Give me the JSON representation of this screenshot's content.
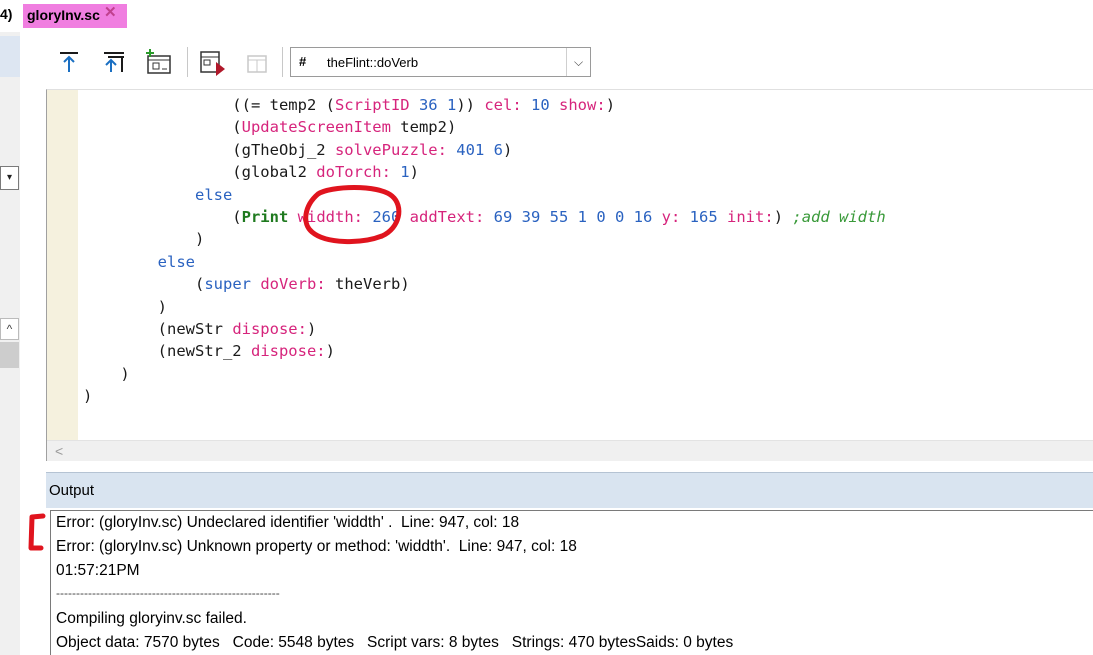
{
  "tabs": {
    "prev_label": "4)",
    "active_label": "gloryInv.sc",
    "close_symbol": "✕"
  },
  "toolbar": {
    "method_hash": "#",
    "method_value": "theFlint::doVerb",
    "dropdown_arrow": "⌵"
  },
  "left_strip": {
    "dropdown_arrow": "▾",
    "scroll_up": "^"
  },
  "editor": {
    "scroll_left": "<",
    "lines": [
      [
        {
          "t": "                ((= temp2 (",
          "c": "t-black"
        },
        {
          "t": "ScriptID",
          "c": "t-magenta"
        },
        {
          "t": " ",
          "c": "t-black"
        },
        {
          "t": "36",
          "c": "t-num"
        },
        {
          "t": " ",
          "c": "t-black"
        },
        {
          "t": "1",
          "c": "t-num"
        },
        {
          "t": ")) ",
          "c": "t-black"
        },
        {
          "t": "cel:",
          "c": "t-magenta"
        },
        {
          "t": " ",
          "c": "t-black"
        },
        {
          "t": "10",
          "c": "t-num"
        },
        {
          "t": " ",
          "c": "t-black"
        },
        {
          "t": "show:",
          "c": "t-magenta"
        },
        {
          "t": ")",
          "c": "t-black"
        }
      ],
      [
        {
          "t": "                (",
          "c": "t-black"
        },
        {
          "t": "UpdateScreenItem",
          "c": "t-magenta"
        },
        {
          "t": " temp2)",
          "c": "t-black"
        }
      ],
      [
        {
          "t": "                (gTheObj_2 ",
          "c": "t-black"
        },
        {
          "t": "solvePuzzle:",
          "c": "t-magenta"
        },
        {
          "t": " ",
          "c": "t-black"
        },
        {
          "t": "401",
          "c": "t-num"
        },
        {
          "t": " ",
          "c": "t-black"
        },
        {
          "t": "6",
          "c": "t-num"
        },
        {
          "t": ")",
          "c": "t-black"
        }
      ],
      [
        {
          "t": "                (global2 ",
          "c": "t-black"
        },
        {
          "t": "doTorch:",
          "c": "t-magenta"
        },
        {
          "t": " ",
          "c": "t-black"
        },
        {
          "t": "1",
          "c": "t-num"
        },
        {
          "t": ")",
          "c": "t-black"
        }
      ],
      [
        {
          "t": "            ",
          "c": "t-black"
        },
        {
          "t": "else",
          "c": "t-blue-kw"
        }
      ],
      [
        {
          "t": "                (",
          "c": "t-black"
        },
        {
          "t": "Print",
          "c": "t-kw-green"
        },
        {
          "t": " ",
          "c": "t-black"
        },
        {
          "t": "widdth:",
          "c": "t-magenta"
        },
        {
          "t": " ",
          "c": "t-black"
        },
        {
          "t": "260",
          "c": "t-num"
        },
        {
          "t": " ",
          "c": "t-black"
        },
        {
          "t": "addText:",
          "c": "t-magenta"
        },
        {
          "t": " ",
          "c": "t-black"
        },
        {
          "t": "69 39 55 1 0 0 16",
          "c": "t-num"
        },
        {
          "t": " ",
          "c": "t-black"
        },
        {
          "t": "y:",
          "c": "t-magenta"
        },
        {
          "t": " ",
          "c": "t-black"
        },
        {
          "t": "165",
          "c": "t-num"
        },
        {
          "t": " ",
          "c": "t-black"
        },
        {
          "t": "init:",
          "c": "t-magenta"
        },
        {
          "t": ") ",
          "c": "t-black"
        },
        {
          "t": ";add width",
          "c": "t-comment"
        }
      ],
      [
        {
          "t": "            )",
          "c": "t-black"
        }
      ],
      [
        {
          "t": "        ",
          "c": "t-black"
        },
        {
          "t": "else",
          "c": "t-blue-kw"
        }
      ],
      [
        {
          "t": "            (",
          "c": "t-black"
        },
        {
          "t": "super",
          "c": "t-blue-kw"
        },
        {
          "t": " ",
          "c": "t-black"
        },
        {
          "t": "doVerb:",
          "c": "t-magenta"
        },
        {
          "t": " theVerb)",
          "c": "t-black"
        }
      ],
      [
        {
          "t": "        )",
          "c": "t-black"
        }
      ],
      [
        {
          "t": "        (newStr ",
          "c": "t-black"
        },
        {
          "t": "dispose:",
          "c": "t-magenta"
        },
        {
          "t": ")",
          "c": "t-black"
        }
      ],
      [
        {
          "t": "        (newStr_2 ",
          "c": "t-black"
        },
        {
          "t": "dispose:",
          "c": "t-magenta"
        },
        {
          "t": ")",
          "c": "t-black"
        }
      ],
      [
        {
          "t": "    )",
          "c": "t-black"
        }
      ],
      [
        {
          "t": ")",
          "c": "t-black"
        }
      ]
    ]
  },
  "output": {
    "title": "Output",
    "lines": [
      "Error: (gloryInv.sc) Undeclared identifier 'widdth' .  Line: 947, col: 18",
      "Error: (gloryInv.sc) Unknown property or method: 'widdth'.  Line: 947, col: 18",
      "01:57:21PM",
      "--------------------------------------------------------",
      "Compiling gloryinv.sc failed.",
      "Object data: 7570 bytes   Code: 5548 bytes   Script vars: 8 bytes   Strings: 470 bytesSaids: 0 bytes"
    ]
  }
}
